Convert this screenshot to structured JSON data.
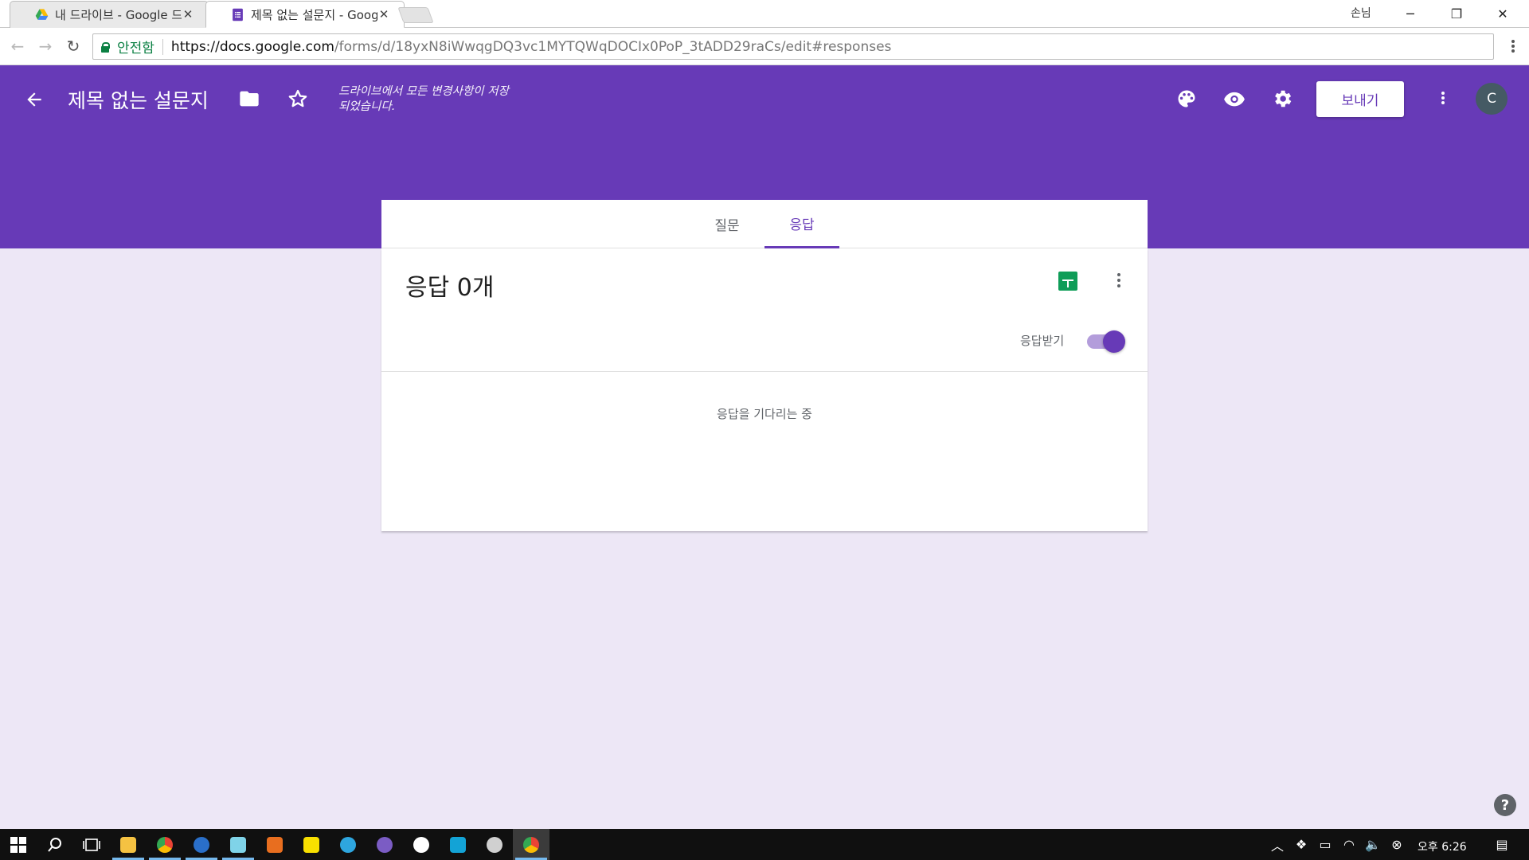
{
  "browser": {
    "tabs": [
      {
        "title": "내 드라이브 - Google 드라이브",
        "active": false,
        "favicon": "google-drive-icon"
      },
      {
        "title": "제목 없는 설문지 - Google Forms",
        "active": true,
        "favicon": "google-forms-icon"
      }
    ],
    "profile_name": "손님",
    "window_buttons": {
      "minimize": "─",
      "restore": "❐",
      "close": "✕"
    },
    "secure_label": "안전함",
    "url_host": "https://docs.google.com",
    "url_path": "/forms/d/18yxN8iWwqgDQ3vc1MYTQWqDOCIx0PoP_3tADD29raCs/edit#responses"
  },
  "header": {
    "title": "제목 없는 설문지",
    "save_status": "드라이브에서 모든 변경사항이 저장되었습니다.",
    "send_label": "보내기",
    "avatar_letter": "C",
    "accent_color": "#673ab7"
  },
  "form_tabs": [
    {
      "label": "질문",
      "active": false
    },
    {
      "label": "응답",
      "active": true
    }
  ],
  "responses": {
    "count_label": "응답 0개",
    "accepting_label": "응답받기",
    "accepting": true,
    "waiting_text": "응답을 기다리는 중"
  },
  "taskbar": {
    "clock": "오후 6:26",
    "apps": [
      "file-explorer-icon",
      "chrome-icon",
      "app-icon",
      "notepad-icon",
      "visual-studio-icon",
      "kakaotalk-icon",
      "telegram-icon",
      "app-icon",
      "app-icon",
      "app-icon",
      "app-icon",
      "chrome-icon"
    ]
  }
}
